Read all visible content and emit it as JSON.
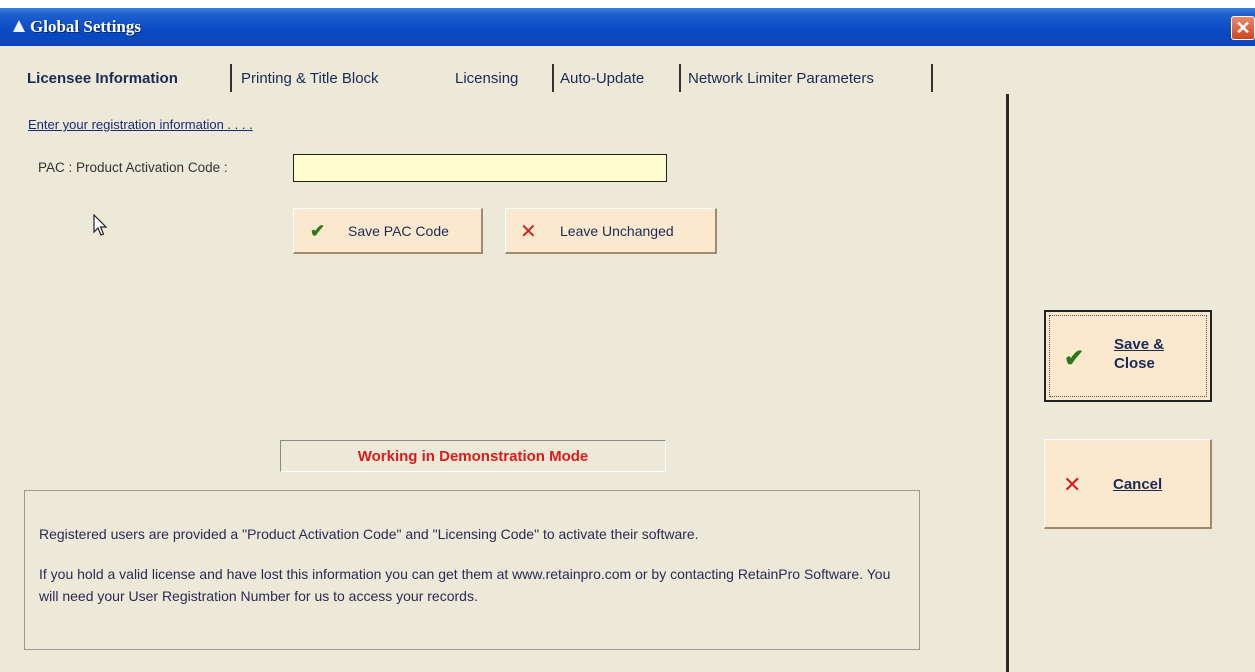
{
  "window": {
    "title": "Global Settings",
    "close_glyph": "✕"
  },
  "tabs": [
    {
      "label": "Licensee Information",
      "active": true
    },
    {
      "label": "Printing & Title Block",
      "active": false
    },
    {
      "label": "Licensing",
      "active": false
    },
    {
      "label": "Auto-Update",
      "active": false
    },
    {
      "label": "Network Limiter Parameters",
      "active": false
    }
  ],
  "form": {
    "registration_link": "Enter your registration information . . . .",
    "pac_label": "PAC  :  Product Activation Code  :",
    "pac_value": "",
    "pac_placeholder": ""
  },
  "buttons": {
    "save_pac": "Save PAC Code",
    "leave_unchanged": "Leave Unchanged",
    "save_close_line1": "Save &",
    "save_close_line2": "Close",
    "cancel": "Cancel"
  },
  "status": {
    "text": "Working in Demonstration Mode"
  },
  "info": {
    "paragraph1": "Registered users are provided a \"Product Activation Code\" and \"Licensing Code\" to activate their software.",
    "paragraph2": "If you hold a valid license and have lost this information you can get them at www.retainpro.com or by contacting RetainPro Software. You will need your User Registration Number for us to access your records."
  },
  "colors": {
    "titlebar": "#0a49c4",
    "status_text": "#e01a1a",
    "input_bg": "#fffdd0",
    "button_bg": "#fbe9cf"
  }
}
